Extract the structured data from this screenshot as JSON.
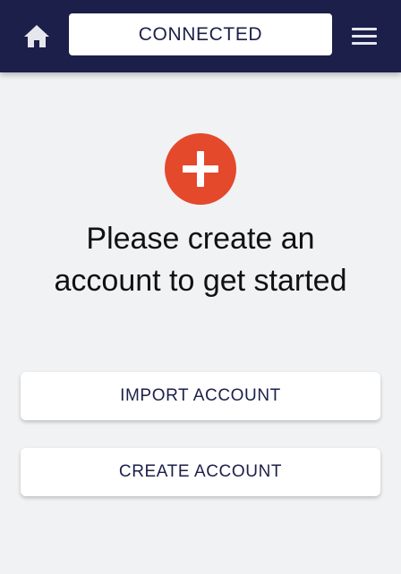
{
  "header": {
    "status_label": "CONNECTED",
    "home_icon": "home-icon",
    "menu_icon": "hamburger-menu-icon",
    "background_color": "#1c1f4a"
  },
  "main": {
    "badge_icon": "plus-icon",
    "badge_color": "#e4492c",
    "headline_line1": "Please create an",
    "headline_line2": "account to get started"
  },
  "actions": {
    "import_label": "IMPORT ACCOUNT",
    "create_label": "CREATE ACCOUNT"
  }
}
